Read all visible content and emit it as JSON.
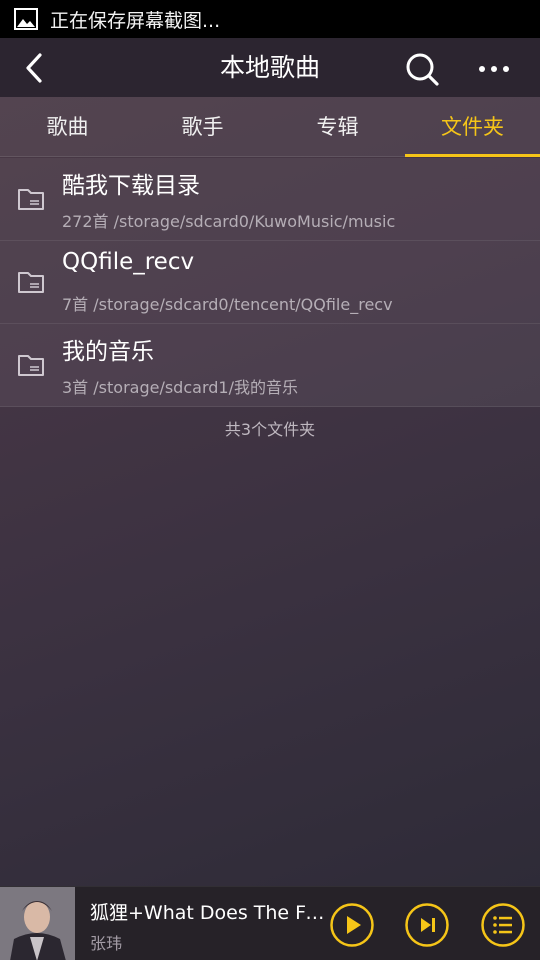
{
  "status_bar": {
    "notification_text": "正在保存屏幕截图..."
  },
  "header": {
    "title": "本地歌曲"
  },
  "tabs": [
    {
      "label": "歌曲",
      "active": false
    },
    {
      "label": "歌手",
      "active": false
    },
    {
      "label": "专辑",
      "active": false
    },
    {
      "label": "文件夹",
      "active": true
    }
  ],
  "folders": [
    {
      "name": "酷我下载目录",
      "count": "272首",
      "path": "/storage/sdcard0/KuwoMusic/music"
    },
    {
      "name": "QQfile_recv",
      "count": "7首",
      "path": "/storage/sdcard0/tencent/QQfile_recv"
    },
    {
      "name": "我的音乐",
      "count": "3首",
      "path": "/storage/sdcard1/我的音乐"
    }
  ],
  "summary": "共3个文件夹",
  "player": {
    "song": "狐狸+What Does The Fox Say",
    "artist": "张玮"
  },
  "colors": {
    "accent": "#f5c518",
    "background": "#3f3341"
  }
}
